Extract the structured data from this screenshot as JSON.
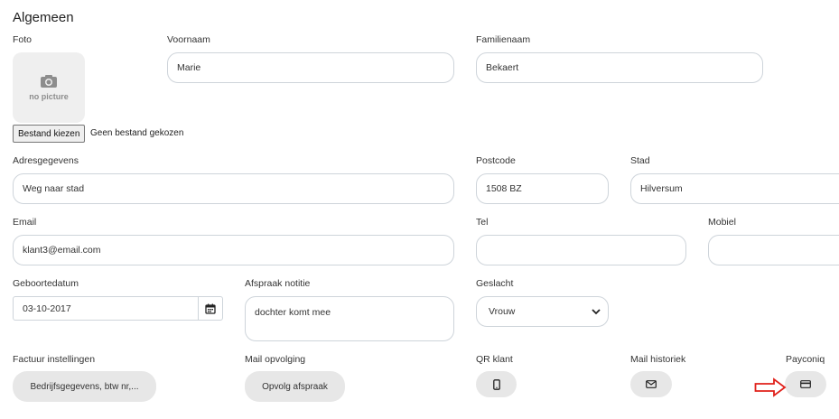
{
  "section": {
    "title": "Algemeen"
  },
  "photo": {
    "label": "Foto",
    "placeholder_text": "no picture",
    "icon": "camera-icon"
  },
  "file_input": {
    "button_label": "Bestand kiezen",
    "status": "Geen bestand gekozen"
  },
  "fields": {
    "voornaam": {
      "label": "Voornaam",
      "value": "Marie"
    },
    "familienaam": {
      "label": "Familienaam",
      "value": "Bekaert"
    },
    "adres": {
      "label": "Adresgegevens",
      "value": "Weg naar stad"
    },
    "postcode": {
      "label": "Postcode",
      "value": "1508 BZ"
    },
    "stad": {
      "label": "Stad",
      "value": "Hilversum"
    },
    "email": {
      "label": "Email",
      "value": "klant3@email.com"
    },
    "tel": {
      "label": "Tel",
      "value": ""
    },
    "mobiel": {
      "label": "Mobiel",
      "value": ""
    },
    "geboortedatum": {
      "label": "Geboortedatum",
      "value": "03-10-2017"
    },
    "afspraak_notitie": {
      "label": "Afspraak notitie",
      "value": "dochter komt mee"
    },
    "geslacht": {
      "label": "Geslacht",
      "selected": "Vrouw"
    }
  },
  "actions": {
    "factuur": {
      "label": "Factuur instellingen",
      "button": "Bedrijfsgegevens, btw nr,..."
    },
    "mail_opvolging": {
      "label": "Mail opvolging",
      "button": "Opvolg afspraak"
    },
    "qr": {
      "label": "QR klant",
      "icon": "phone-icon"
    },
    "mail_historiek": {
      "label": "Mail historiek",
      "icon": "envelope-icon"
    },
    "payconiq": {
      "label": "Payconiq",
      "icon": "credit-card-icon"
    }
  },
  "annotation": {
    "icon": "red-arrow-icon",
    "color": "#e0201a"
  }
}
